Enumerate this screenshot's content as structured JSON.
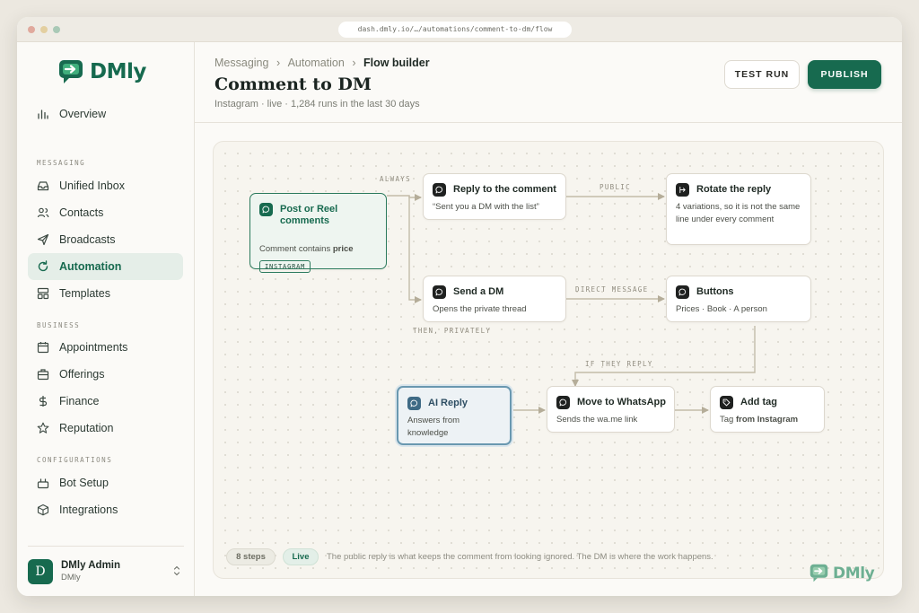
{
  "browser": {
    "url": "dash.dmly.io/…/automations/comment-to-dm/flow"
  },
  "brand": {
    "name": "DMly",
    "color": "#176a4f"
  },
  "sidebar": {
    "overview": {
      "label": "Overview",
      "icon": "bar-chart-icon"
    },
    "sections": [
      {
        "label": "MESSAGING"
      },
      {
        "label": "BUSINESS"
      },
      {
        "label": "CONFIGURATIONS"
      }
    ],
    "items": [
      {
        "label": "Unified Inbox",
        "icon": "inbox-icon"
      },
      {
        "label": "Contacts",
        "icon": "users-icon"
      },
      {
        "label": "Broadcasts",
        "icon": "send-icon"
      },
      {
        "label": "Automation",
        "icon": "refresh-icon",
        "active": true
      },
      {
        "label": "Templates",
        "icon": "template-icon"
      },
      {
        "label": "Appointments",
        "icon": "calendar-icon"
      },
      {
        "label": "Offerings",
        "icon": "briefcase-icon"
      },
      {
        "label": "Finance",
        "icon": "dollar-icon"
      },
      {
        "label": "Reputation",
        "icon": "star-icon"
      },
      {
        "label": "Bot Setup",
        "icon": "bot-icon"
      },
      {
        "label": "Integrations",
        "icon": "cube-icon"
      }
    ],
    "profile": {
      "initial": "D",
      "name": "DMly Admin",
      "org": "DMly"
    }
  },
  "header": {
    "crumbs": [
      "Messaging",
      "Automation",
      "Flow builder"
    ],
    "sep": "›",
    "title": "Comment to DM",
    "subtitle": "Instagram · live · 1,284 runs in the last 30 days",
    "test_run": "TEST RUN",
    "publish": "PUBLISH"
  },
  "flow": {
    "nodes": {
      "trigger": {
        "title": "Post or Reel comments",
        "desc_prefix": "Comment contains ",
        "desc_keyword": "price",
        "tag": "INSTAGRAM"
      },
      "reply": {
        "title": "Reply to the comment",
        "desc": "“Sent you a DM with the list”"
      },
      "rotate": {
        "title": "Rotate the reply",
        "desc": "4 variations, so it is not the same line under every comment"
      },
      "send_dm": {
        "title": "Send a DM",
        "desc": "Opens the private thread"
      },
      "buttons": {
        "title": "Buttons",
        "desc": "Prices · Book · A person"
      },
      "ai": {
        "title": "AI Reply",
        "desc": "Answers from knowledge"
      },
      "whatsapp": {
        "title": "Move to WhatsApp",
        "desc": "Sends the wa.me link"
      },
      "add_tag": {
        "title": "Add tag",
        "desc_prefix": "Tag ",
        "desc_bold": "from Instagram"
      }
    },
    "edge_labels": {
      "always": "ALWAYS",
      "then_privately": "THEN, PRIVATELY",
      "public": "PUBLIC",
      "direct_message": "DIRECT MESSAGE",
      "if_they_reply": "IF THEY REPLY"
    },
    "footer": {
      "steps": "8 steps",
      "status": "Live",
      "note": "The public reply is what keeps the comment from looking ignored. The DM is where the work happens."
    }
  }
}
